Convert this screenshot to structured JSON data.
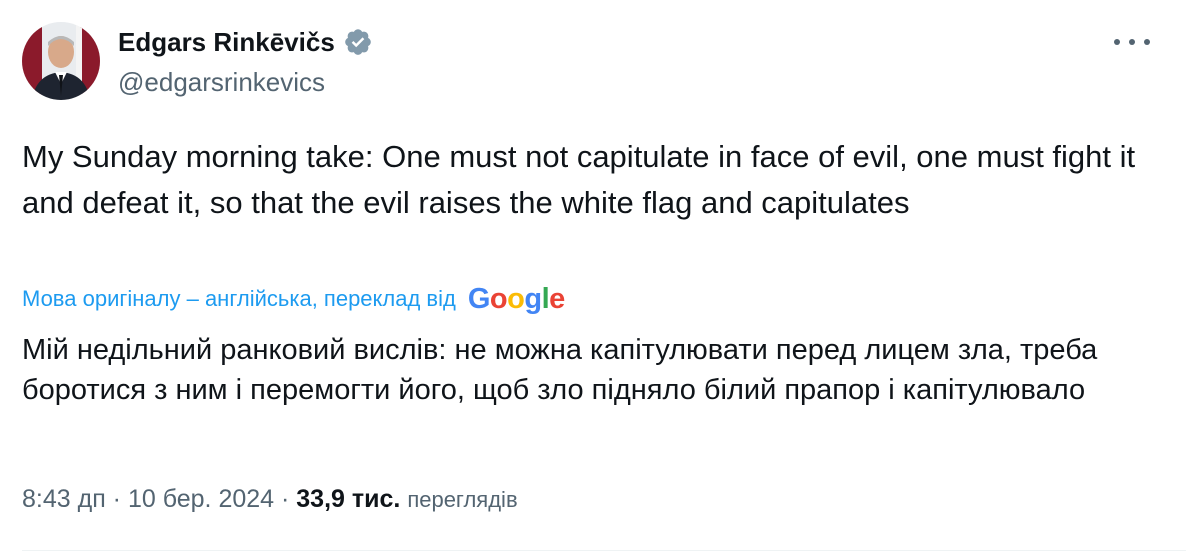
{
  "author": {
    "name": "Edgars Rinkēvičs",
    "handle": "@edgarsrinkevics",
    "verified": true,
    "avatar_icon": "profile-photo"
  },
  "menu": {
    "icon": "more-icon"
  },
  "tweet": {
    "text": "My Sunday morning take: One must not capitulate in face of evil, one must fight it and defeat it, so that the evil raises the white flag and capitulates",
    "translation_note": "Мова оригіналу – англійська, переклад від",
    "translation_provider": "Google",
    "translated_text": "Мій недільний ранковий вислів: не можна капітулювати перед лицем зла, треба боротися з ним і перемогти його, щоб зло підняло білий прапор і капітулювало"
  },
  "meta": {
    "time": "8:43 дп",
    "separator1": " · ",
    "date": "10 бер. 2024",
    "separator2": " · ",
    "views_count": "33,9 тис.",
    "views_label": "переглядів"
  },
  "colors": {
    "link": "#1d9bf0",
    "secondary_text": "#536471",
    "primary_text": "#0f1419",
    "google_blue": "#4285f4",
    "google_red": "#ea4335",
    "google_yellow": "#fbbc05",
    "google_green": "#34a853"
  }
}
